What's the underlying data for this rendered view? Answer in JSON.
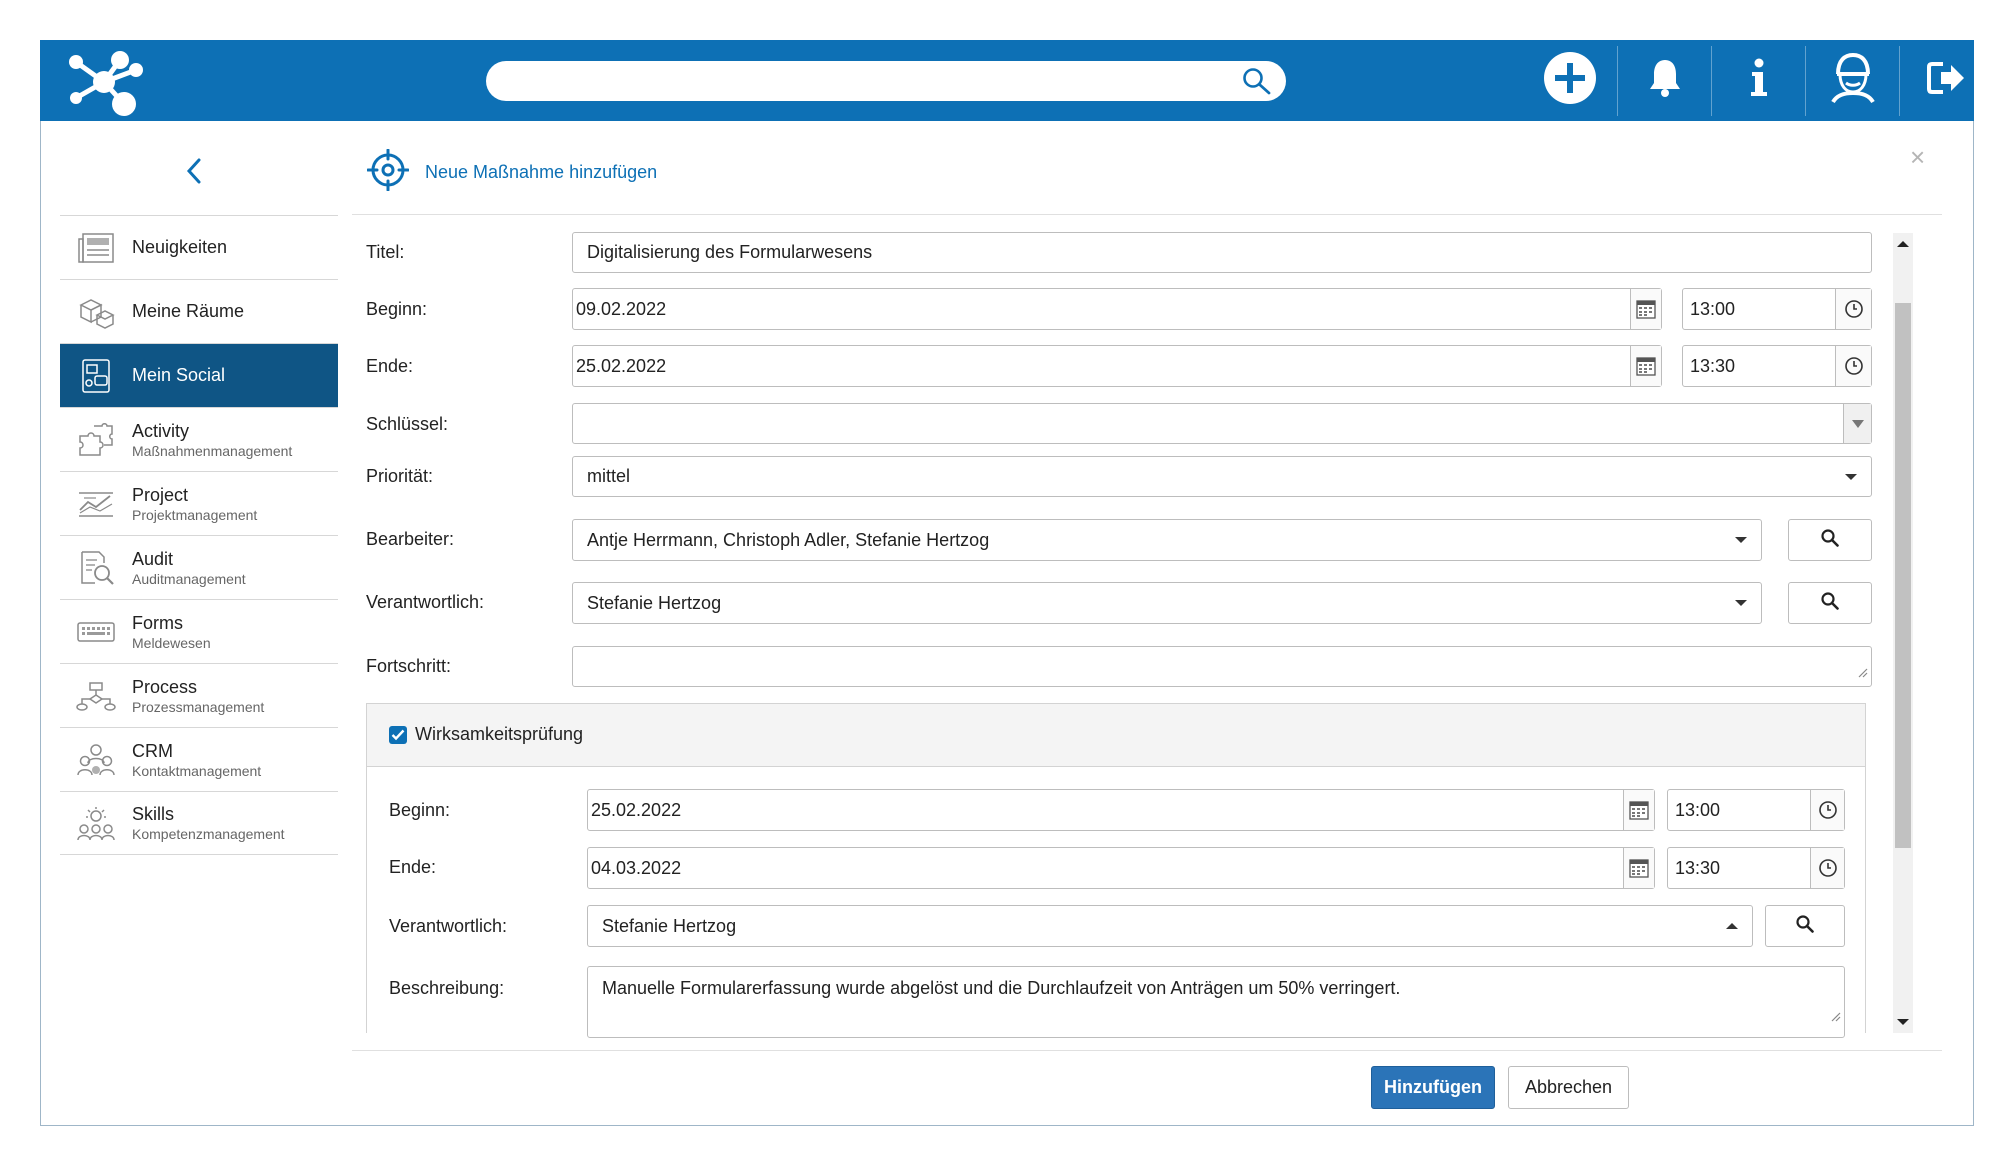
{
  "header": {
    "search_placeholder": "",
    "icons": [
      "logo-icon",
      "search-icon",
      "add-icon",
      "bell-icon",
      "info-icon",
      "user-avatar-icon",
      "logout-icon"
    ]
  },
  "sidebar": {
    "items": [
      {
        "label": "Neuigkeiten",
        "sub": "",
        "icon": "news-icon"
      },
      {
        "label": "Meine Räume",
        "sub": "",
        "icon": "rooms-icon"
      },
      {
        "label": "Mein Social",
        "sub": "",
        "icon": "social-icon",
        "active": true
      },
      {
        "label": "Activity",
        "sub": "Maßnahmenmanagement",
        "icon": "puzzle-icon"
      },
      {
        "label": "Project",
        "sub": "Projektmanagement",
        "icon": "chart-icon"
      },
      {
        "label": "Audit",
        "sub": "Auditmanagement",
        "icon": "audit-icon"
      },
      {
        "label": "Forms",
        "sub": "Meldewesen",
        "icon": "keyboard-icon"
      },
      {
        "label": "Process",
        "sub": "Prozessmanagement",
        "icon": "process-icon"
      },
      {
        "label": "CRM",
        "sub": "Kontaktmanagement",
        "icon": "crm-icon"
      },
      {
        "label": "Skills",
        "sub": "Kompetenzmanagement",
        "icon": "skills-icon"
      }
    ]
  },
  "dialog": {
    "title": "Neue Maßnahme hinzufügen",
    "close": "×",
    "form": {
      "titel_label": "Titel:",
      "titel_value": "Digitalisierung des Formularwesens",
      "beginn_label": "Beginn:",
      "beginn_date": "09.02.2022",
      "beginn_time": "13:00",
      "ende_label": "Ende:",
      "ende_date": "25.02.2022",
      "ende_time": "13:30",
      "schluessel_label": "Schlüssel:",
      "schluessel_value": "",
      "prioritaet_label": "Priorität:",
      "prioritaet_value": "mittel",
      "bearbeiter_label": "Bearbeiter:",
      "bearbeiter_value": "Antje Herrmann, Christoph Adler, Stefanie Hertzog",
      "verantwortlich_label": "Verantwortlich:",
      "verantwortlich_value": "Stefanie Hertzog",
      "fortschritt_label": "Fortschritt:",
      "fortschritt_value": ""
    },
    "wirksamkeit": {
      "checkbox_label": "Wirksamkeitsprüfung",
      "checked": true,
      "beginn_label": "Beginn:",
      "beginn_date": "25.02.2022",
      "beginn_time": "13:00",
      "ende_label": "Ende:",
      "ende_date": "04.03.2022",
      "ende_time": "13:30",
      "verantwortlich_label": "Verantwortlich:",
      "verantwortlich_value": "Stefanie Hertzog",
      "beschreibung_label": "Beschreibung:",
      "beschreibung_value": "Manuelle Formularerfassung wurde abgelöst und die Durchlaufzeit von Anträgen um 50% verringert."
    },
    "buttons": {
      "submit": "Hinzufügen",
      "cancel": "Abbrechen"
    }
  },
  "colors": {
    "brand": "#0d70b5",
    "active_nav": "#0f5585",
    "primary_button": "#2b74b8"
  }
}
